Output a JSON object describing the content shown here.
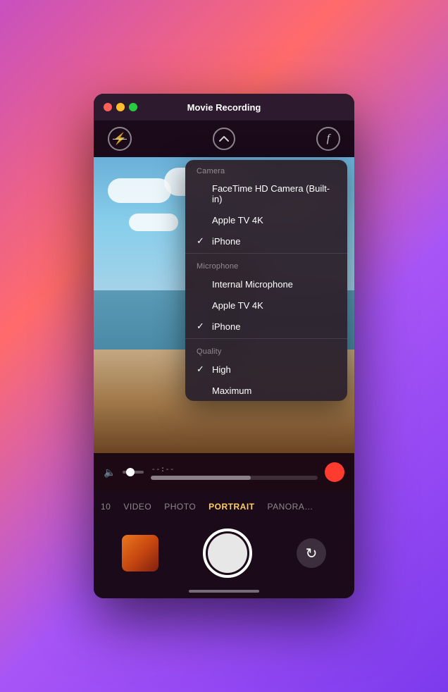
{
  "window": {
    "title": "Movie Recording"
  },
  "controls": {
    "flash_label": "✕",
    "chevron_label": "⌃",
    "face_label": "f"
  },
  "recording": {
    "time": "--:--",
    "record_btn_label": "●"
  },
  "mode_tabs": [
    {
      "label": "10",
      "active": false
    },
    {
      "label": "VIDEO",
      "active": false
    },
    {
      "label": "PHOTO",
      "active": false
    },
    {
      "label": "PORTRAIT",
      "active": true
    },
    {
      "label": "PANORAMA",
      "active": false
    }
  ],
  "dropdown": {
    "camera_section": "Camera",
    "camera_items": [
      {
        "label": "FaceTime HD Camera (Built-in)",
        "checked": false
      },
      {
        "label": "Apple TV 4K",
        "checked": false
      },
      {
        "label": "iPhone",
        "checked": true
      }
    ],
    "microphone_section": "Microphone",
    "microphone_items": [
      {
        "label": "Internal Microphone",
        "checked": false
      },
      {
        "label": "Apple TV 4K",
        "checked": false
      },
      {
        "label": "iPhone",
        "checked": true
      }
    ],
    "quality_section": "Quality",
    "quality_items": [
      {
        "label": "High",
        "checked": true
      },
      {
        "label": "Maximum",
        "checked": false
      }
    ]
  }
}
